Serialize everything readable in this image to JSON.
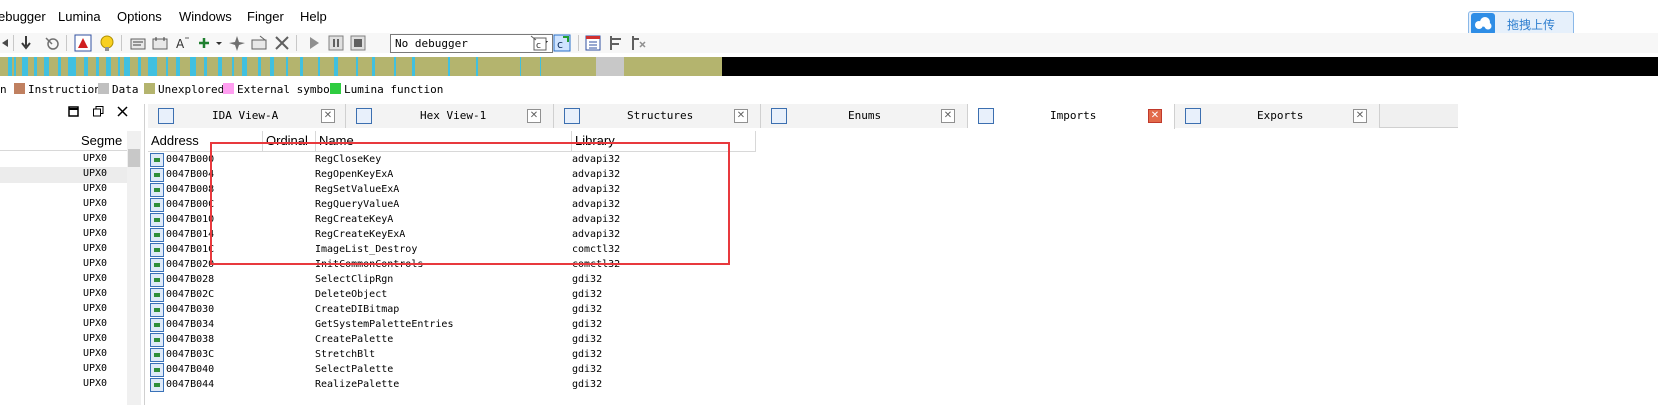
{
  "menubar": {
    "items": [
      "ebugger",
      "Lumina",
      "Options",
      "Windows",
      "Finger",
      "Help"
    ],
    "upload_button": "拖拽上传"
  },
  "toolbar": {
    "debugger_select": "No debugger"
  },
  "legend": {
    "items": [
      {
        "label": "n",
        "color": ""
      },
      {
        "label": "Instruction",
        "color": "#c08060"
      },
      {
        "label": "Data",
        "color": "#c0c0c0"
      },
      {
        "label": "Unexplored",
        "color": "#b4b46e"
      },
      {
        "label": "External symbol",
        "color": "#ff9ef0"
      },
      {
        "label": "Lumina function",
        "color": "#2ecc40"
      }
    ]
  },
  "colors": {
    "navbar_fill": "#b4b46e",
    "navbar_code": "#40c0e0",
    "highlight_border": "#e8393d"
  },
  "left_panel": {
    "column_header": "Segme",
    "segments": [
      "UPX0",
      "UPX0",
      "UPX0",
      "UPX0",
      "UPX0",
      "UPX0",
      "UPX0",
      "UPX0",
      "UPX0",
      "UPX0",
      "UPX0",
      "UPX0",
      "UPX0",
      "UPX0",
      "UPX0",
      "UPX0"
    ]
  },
  "tabs": [
    {
      "label": "IDA View-A",
      "icon": "disassembly-icon",
      "active": false
    },
    {
      "label": "Hex View-1",
      "icon": "hex-icon",
      "active": false
    },
    {
      "label": "Structures",
      "icon": "structures-icon",
      "active": false
    },
    {
      "label": "Enums",
      "icon": "enums-icon",
      "active": false
    },
    {
      "label": "Imports",
      "icon": "imports-icon",
      "active": true
    },
    {
      "label": "Exports",
      "icon": "exports-icon",
      "active": false
    }
  ],
  "imports": {
    "columns": [
      "Address",
      "Ordinal",
      "Name",
      "Library"
    ],
    "rows": [
      {
        "address": "0047B000",
        "ordinal": "",
        "name": "RegCloseKey",
        "library": "advapi32"
      },
      {
        "address": "0047B004",
        "ordinal": "",
        "name": "RegOpenKeyExA",
        "library": "advapi32"
      },
      {
        "address": "0047B008",
        "ordinal": "",
        "name": "RegSetValueExA",
        "library": "advapi32"
      },
      {
        "address": "0047B00C",
        "ordinal": "",
        "name": "RegQueryValueA",
        "library": "advapi32"
      },
      {
        "address": "0047B010",
        "ordinal": "",
        "name": "RegCreateKeyA",
        "library": "advapi32"
      },
      {
        "address": "0047B014",
        "ordinal": "",
        "name": "RegCreateKeyExA",
        "library": "advapi32"
      },
      {
        "address": "0047B01C",
        "ordinal": "",
        "name": "ImageList_Destroy",
        "library": "comctl32"
      },
      {
        "address": "0047B020",
        "ordinal": "",
        "name": "InitCommonControls",
        "library": "comctl32"
      },
      {
        "address": "0047B028",
        "ordinal": "",
        "name": "SelectClipRgn",
        "library": "gdi32"
      },
      {
        "address": "0047B02C",
        "ordinal": "",
        "name": "DeleteObject",
        "library": "gdi32"
      },
      {
        "address": "0047B030",
        "ordinal": "",
        "name": "CreateDIBitmap",
        "library": "gdi32"
      },
      {
        "address": "0047B034",
        "ordinal": "",
        "name": "GetSystemPaletteEntries",
        "library": "gdi32"
      },
      {
        "address": "0047B038",
        "ordinal": "",
        "name": "CreatePalette",
        "library": "gdi32"
      },
      {
        "address": "0047B03C",
        "ordinal": "",
        "name": "StretchBlt",
        "library": "gdi32"
      },
      {
        "address": "0047B040",
        "ordinal": "",
        "name": "SelectPalette",
        "library": "gdi32"
      },
      {
        "address": "0047B044",
        "ordinal": "",
        "name": "RealizePalette",
        "library": "gdi32"
      }
    ]
  }
}
